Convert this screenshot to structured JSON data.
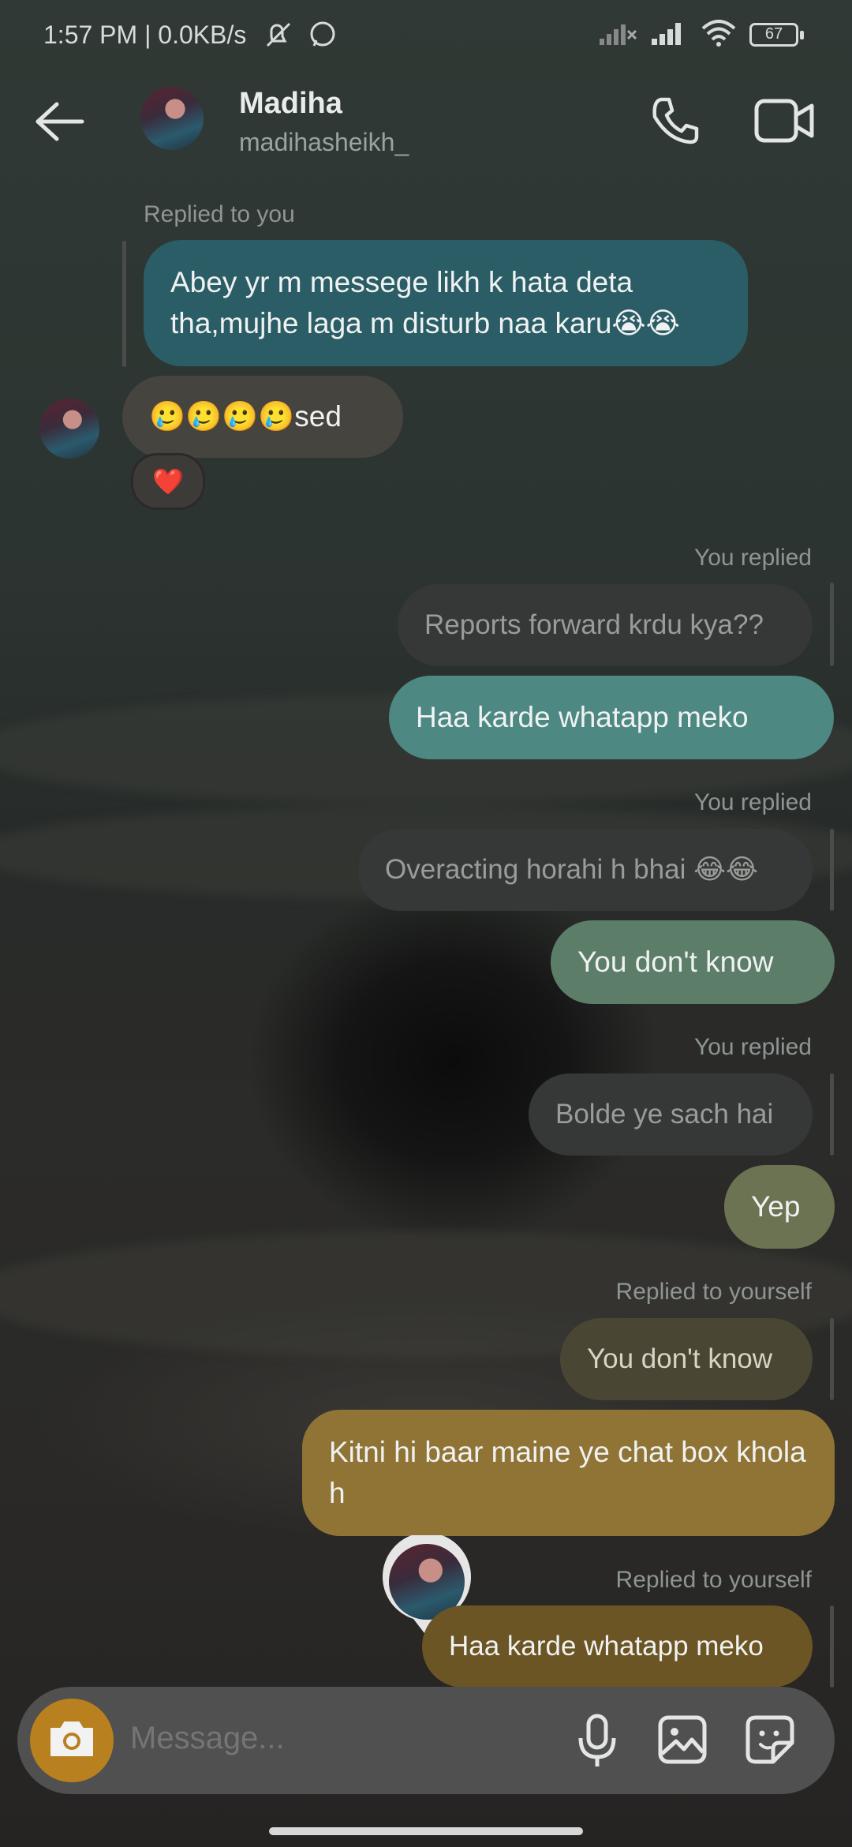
{
  "status_bar": {
    "time_speed": "1:57 PM | 0.0KB/s",
    "battery": "67"
  },
  "header": {
    "name": "Madiha",
    "username": "madihasheikh_"
  },
  "messages": {
    "m1": {
      "meta": "Replied to you",
      "text": "Abey yr m messege likh k hata deta tha,mujhe laga m disturb naa karu😭😭"
    },
    "m2": {
      "text": "🥲🥲🥲🥲sed",
      "reaction": "❤️"
    },
    "m3": {
      "meta": "You replied",
      "quote": "Reports forward krdu kya??",
      "text": "Haa karde whatapp meko"
    },
    "m4": {
      "meta": "You replied",
      "quote": "Overacting horahi h bhai 😂😂",
      "text": "You don't know"
    },
    "m5": {
      "meta": "You replied",
      "quote": "Bolde ye sach hai",
      "text": "Yep"
    },
    "m6": {
      "meta": "Replied to yourself",
      "quote": "You don't know",
      "text": "Kitni hi baar maine ye chat box khola h"
    },
    "m7": {
      "meta": "Replied to yourself",
      "text": "Haa karde whatapp meko"
    }
  },
  "composer": {
    "placeholder": "Message..."
  },
  "colors": {
    "teal": "#2b5d66",
    "green_teal": "#4d8882",
    "sage": "#5c7d68",
    "olive": "#6b7352",
    "olive_dark": "#5a553a",
    "gold": "#8f7436",
    "gold_dark": "#6b5524",
    "camera": "#b9801f"
  },
  "icons": [
    "back-arrow-icon",
    "phone-icon",
    "video-call-icon",
    "microphone-icon",
    "gallery-icon",
    "sticker-icon",
    "camera-icon"
  ]
}
